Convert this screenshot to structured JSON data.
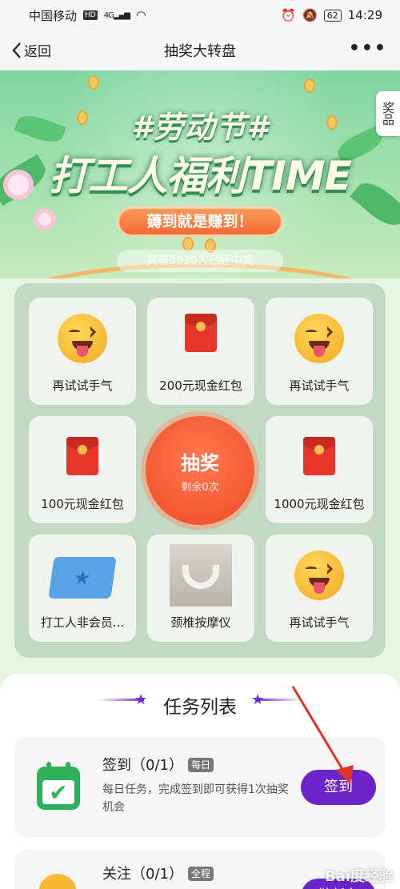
{
  "status_bar": {
    "carrier": "中国移动",
    "hd": "HD",
    "network": "4G",
    "battery": "62",
    "time": "14:29"
  },
  "nav": {
    "back_label": "返回",
    "title": "抽奖大转盘",
    "more_label": "•••"
  },
  "banner": {
    "hashtag": "#劳动节#",
    "headline": "打工人福利TIME",
    "slogan": "薅到就是赚到！",
    "winners_text": "共有3920人已经中奖",
    "prizes_tab": "奖品"
  },
  "lottery": {
    "cells": [
      {
        "label": "再试试手气",
        "icon": "wink-emoji-icon"
      },
      {
        "label": "200元现金红包",
        "icon": "red-envelope-icon"
      },
      {
        "label": "再试试手气",
        "icon": "wink-emoji-icon"
      },
      {
        "label": "100元现金红包",
        "icon": "red-envelope-icon"
      },
      {
        "label": "1000元现金红包",
        "icon": "red-envelope-icon"
      },
      {
        "label": "打工人非会员...",
        "icon": "ticket-icon"
      },
      {
        "label": "颈椎按摩仪",
        "icon": "neck-massager-photo"
      },
      {
        "label": "再试试手气",
        "icon": "wink-emoji-icon"
      }
    ],
    "draw_button": {
      "label": "抽奖",
      "remaining": "剩余0次"
    }
  },
  "tasks": {
    "title": "任务列表",
    "items": [
      {
        "name": "签到（0/1）",
        "badge": "每日",
        "desc": "每日任务，完成签到即可获得1次抽奖机会",
        "button": "签到",
        "icon": "calendar-check-icon"
      },
      {
        "name": "关注（0/1）",
        "badge": "全程",
        "button": "做任务",
        "icon": "person-icon"
      }
    ]
  },
  "watermark": "Bai度经验",
  "colors": {
    "accent_purple": "#6b24c8",
    "draw_orange": "#f04a24",
    "banner_green": "#82d6a3",
    "annotation_red": "#e0332a"
  }
}
